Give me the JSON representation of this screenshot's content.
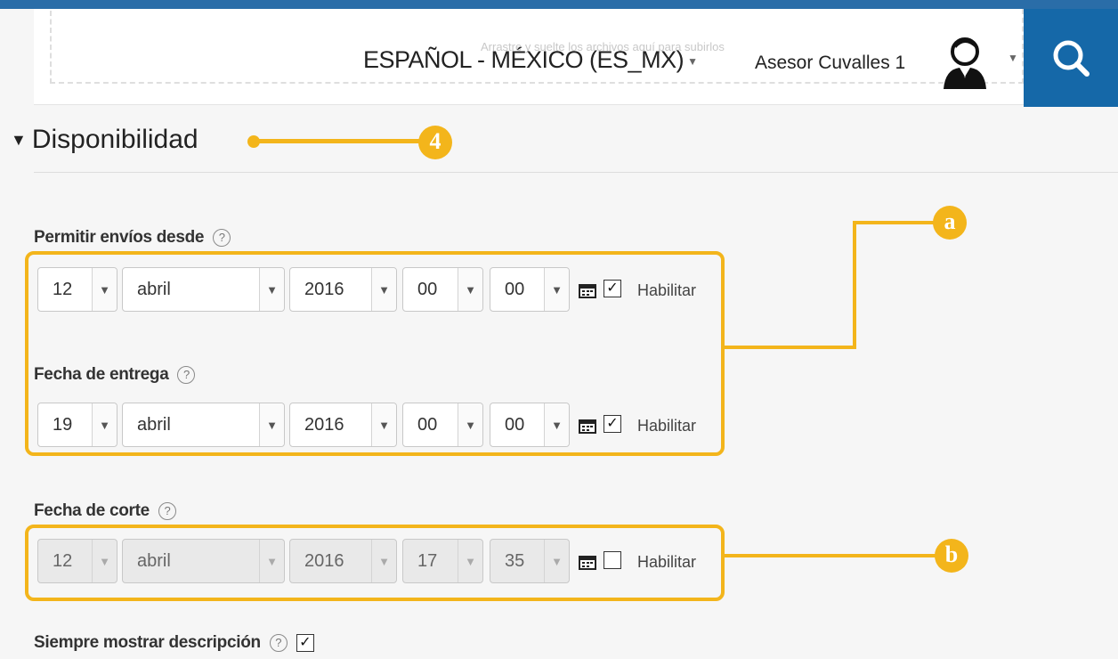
{
  "header": {
    "faded_text": "Arrastre y suelte los archivos aquí para subirlos",
    "language": "ESPAÑOL - MÉXICO (ES_MX)",
    "user_name": "Asesor Cuvalles 1"
  },
  "section": {
    "title": "Disponibilidad",
    "marker": "4"
  },
  "fields": {
    "allow_from": {
      "label": "Permitir envíos desde",
      "help": "?",
      "day": "12",
      "month": "abril",
      "year": "2016",
      "hour": "00",
      "minute": "00",
      "enabled": true,
      "enable_label": "Habilitar"
    },
    "due_date": {
      "label": "Fecha de entrega",
      "help": "?",
      "day": "19",
      "month": "abril",
      "year": "2016",
      "hour": "00",
      "minute": "00",
      "enabled": true,
      "enable_label": "Habilitar"
    },
    "cutoff": {
      "label": "Fecha de corte",
      "help": "?",
      "day": "12",
      "month": "abril",
      "year": "2016",
      "hour": "17",
      "minute": "35",
      "enabled": false,
      "enable_label": "Habilitar"
    },
    "always_show": {
      "label": "Siempre mostrar descripción",
      "help": "?",
      "checked": true
    }
  },
  "annotations": {
    "a": "a",
    "b": "b"
  },
  "colors": {
    "accent": "#f3b51b",
    "header_blue": "#1568a8",
    "top_line": "#2a6da8"
  }
}
